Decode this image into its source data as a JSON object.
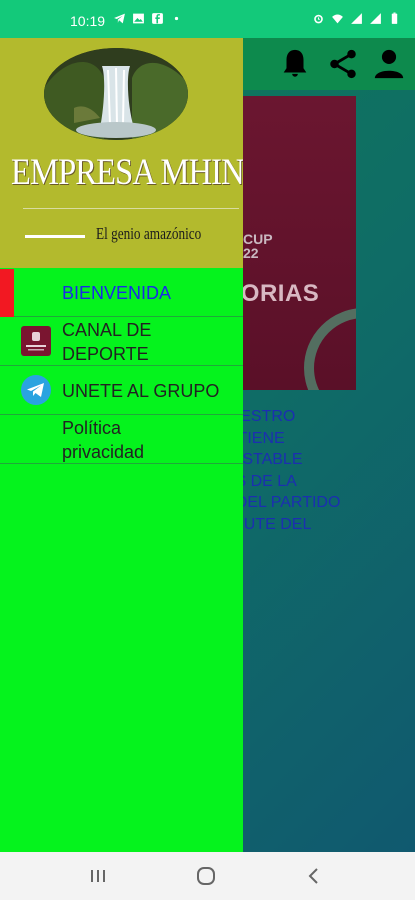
{
  "status_bar": {
    "time": "10:19",
    "icons_left": [
      "telegram-icon",
      "image-icon",
      "facebook-icon",
      "dot-icon"
    ],
    "icons_right": [
      "alarm-icon",
      "wifi-icon",
      "signal-icon",
      "signal-icon",
      "battery-icon"
    ]
  },
  "app": {
    "toolbar_icons": [
      "bell-icon",
      "share-icon",
      "person-icon"
    ],
    "promo": {
      "cup_line1": "CUP",
      "cup_line2": "22",
      "title": "ATORIAS"
    },
    "welcome_text": " EN NUESTRO\nN CONTIENE\nANAL ESTABLE\nRTIDOS DE LA\nHORA DEL PARTIDO\n) DISFRUTE DEL"
  },
  "drawer": {
    "brand_title": "EMPRESA MHIN",
    "slogan": "El genio amazónico",
    "menu": [
      {
        "label": "BIENVENIDA",
        "active": true,
        "icon": ""
      },
      {
        "label": "CANAL DE DEPORTE",
        "active": false,
        "icon": "channel-thumbnail-icon"
      },
      {
        "label": "UNETE AL GRUPO",
        "active": false,
        "icon": "telegram-icon"
      },
      {
        "label": "Política privacidad",
        "active": false,
        "icon": ""
      }
    ]
  },
  "colors": {
    "status_bar": "#13c97a",
    "drawer_bg": "#05f31d",
    "drawer_header": "#b3ba2d",
    "active_marker": "#f21822",
    "active_text": "#1a2ae8"
  },
  "nav_bar": {
    "buttons": [
      "recents-icon",
      "home-icon",
      "back-icon"
    ]
  }
}
